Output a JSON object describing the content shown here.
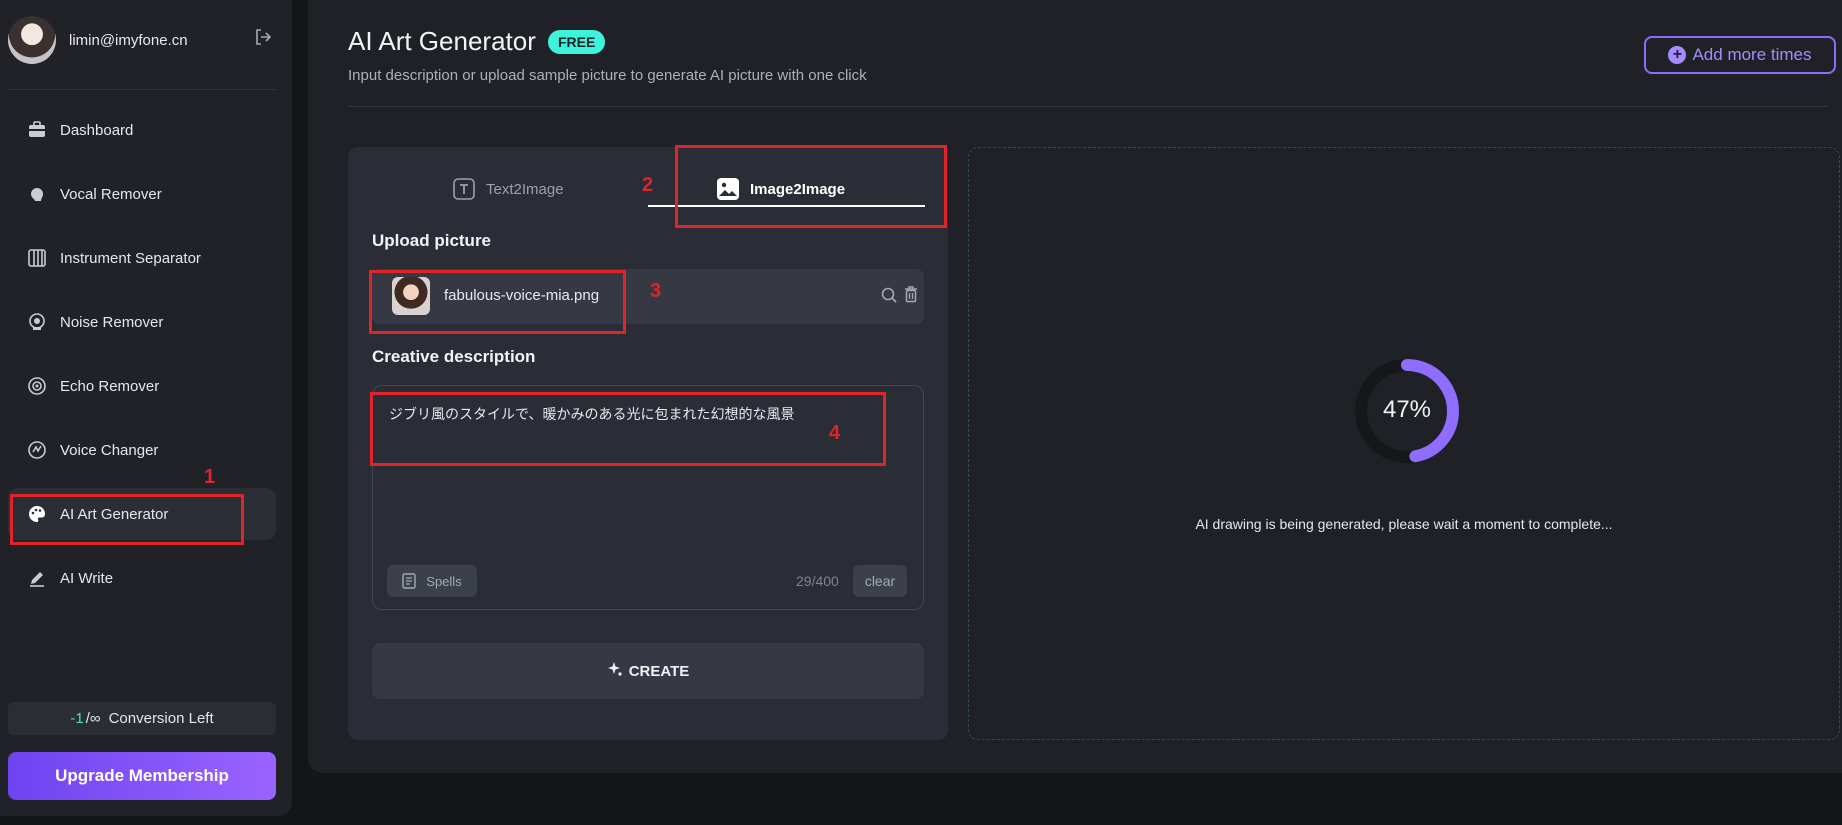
{
  "sidebar": {
    "email": "limin@imyfone.cn",
    "items": [
      {
        "label": "Dashboard",
        "icon": "dashboard-icon"
      },
      {
        "label": "Vocal Remover",
        "icon": "vocal-icon"
      },
      {
        "label": "Instrument Separator",
        "icon": "instrument-icon"
      },
      {
        "label": "Noise Remover",
        "icon": "noise-icon"
      },
      {
        "label": "Echo Remover",
        "icon": "echo-icon"
      },
      {
        "label": "Voice Changer",
        "icon": "voice-icon"
      },
      {
        "label": "AI Art Generator",
        "icon": "palette-icon",
        "active": true
      },
      {
        "label": "AI Write",
        "icon": "pen-icon"
      }
    ],
    "conversion_value": "-1",
    "conversion_slash": "/∞",
    "conversion_label": "Conversion Left",
    "upgrade_label": "Upgrade Membership"
  },
  "header": {
    "title": "AI Art Generator",
    "badge": "FREE",
    "subtitle": "Input description or upload sample picture to generate AI picture with one click",
    "add_more_label": "Add more times"
  },
  "generator": {
    "tabs": [
      {
        "label": "Text2Image",
        "active": false
      },
      {
        "label": "Image2Image",
        "active": true
      }
    ],
    "upload_label": "Upload picture",
    "file_name": "fabulous-voice-mia.png",
    "description_label": "Creative description",
    "description_text": "ジブリ風のスタイルで、暖かみのある光に包まれた幻想的な風景",
    "spells_label": "Spells",
    "counter": "29/400",
    "clear_label": "clear",
    "create_label": "CREATE"
  },
  "progress": {
    "percent": 47,
    "percent_label": "47%",
    "status_text": "AI drawing is being generated, please wait a moment to complete..."
  },
  "annotations": [
    "1",
    "2",
    "3",
    "4"
  ],
  "colors": {
    "accent_purple": "#8b6cff",
    "accent_teal": "#3ff2dc",
    "annotation_red": "#e0242a"
  }
}
